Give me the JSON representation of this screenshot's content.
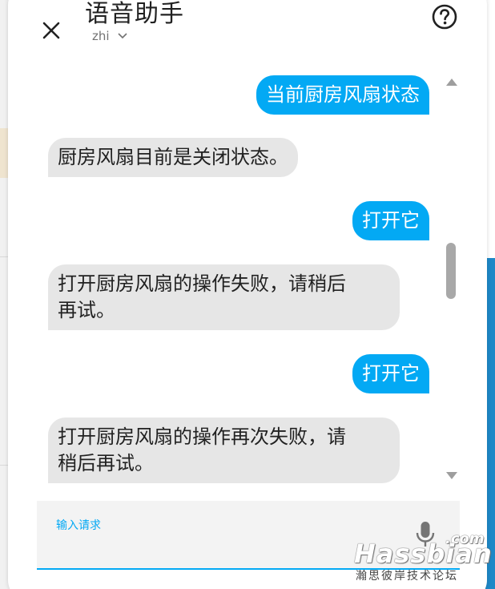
{
  "dialog": {
    "title": "语音助手",
    "language": "zhi",
    "close_icon": "close-icon",
    "help_icon": "help-circle-icon"
  },
  "conversation": [
    {
      "role": "user",
      "text": "当前厨房风扇状态"
    },
    {
      "role": "agent",
      "text": "厨房风扇目前是关闭状态。"
    },
    {
      "role": "user",
      "text": "打开它"
    },
    {
      "role": "agent",
      "lines": [
        "打开厨房风扇的操作失败，请稍后",
        "再试。"
      ]
    },
    {
      "role": "user",
      "text": "打开它"
    },
    {
      "role": "agent",
      "lines": [
        "打开厨房风扇的操作再次失败，请",
        "稍后再试。"
      ]
    }
  ],
  "input": {
    "label": "输入请求",
    "mic_icon": "microphone-icon"
  },
  "watermark": {
    "brand": "Hassbian",
    "domain": ".com",
    "subtitle": "瀚思彼岸技术论坛"
  },
  "colors": {
    "accent": "#03a9f4",
    "user_bubble": "#03a9f4",
    "agent_bubble": "#e6e6e6"
  }
}
